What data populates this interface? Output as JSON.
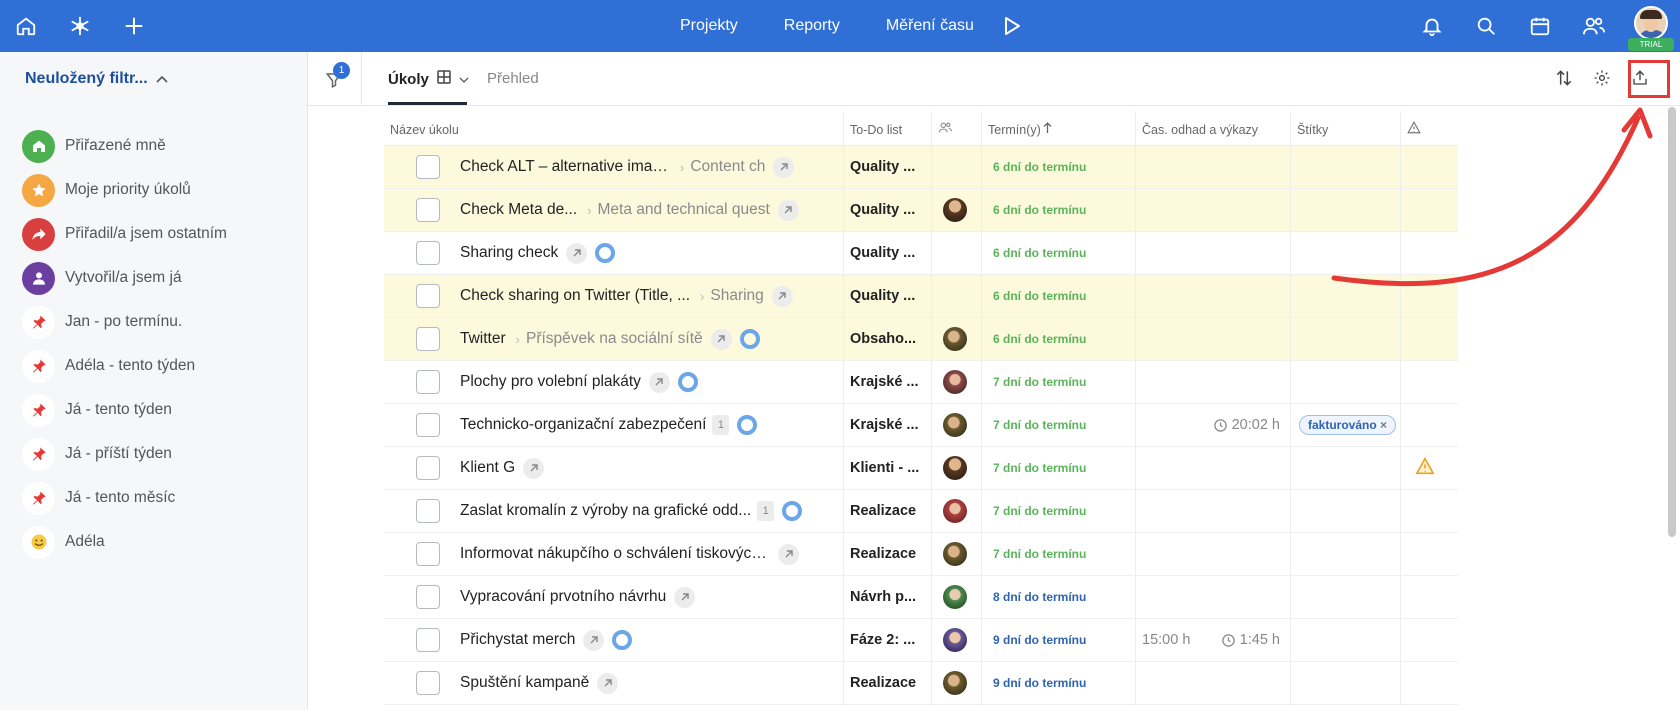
{
  "nav": {
    "links": [
      "Projekty",
      "Reporty",
      "Měření času"
    ],
    "trial_badge": "TRIAL",
    "brand_color": "#2f6fd6"
  },
  "sidebar": {
    "filter_title": "Neuložený filtr...",
    "items": [
      {
        "label": "Přiřazené mně",
        "icon": "home-icon",
        "color": "#4caf50"
      },
      {
        "label": "Moje priority úkolů",
        "icon": "star-icon",
        "color": "#f4a742"
      },
      {
        "label": "Přiřadil/a jsem ostatním",
        "icon": "share-arrow-icon",
        "color": "#d84040"
      },
      {
        "label": "Vytvořil/a jsem já",
        "icon": "person-icon",
        "color": "#6b3fa0"
      },
      {
        "label": "Jan - po termínu.",
        "icon": "pin-icon",
        "color": "#ffffff"
      },
      {
        "label": "Adéla - tento týden",
        "icon": "pin-icon",
        "color": "#ffffff"
      },
      {
        "label": "Já - tento týden",
        "icon": "pin-icon",
        "color": "#ffffff"
      },
      {
        "label": "Já - příští týden",
        "icon": "pin-icon",
        "color": "#ffffff"
      },
      {
        "label": "Já - tento měsíc",
        "icon": "pin-icon",
        "color": "#ffffff"
      },
      {
        "label": "Adéla",
        "icon": "smiley-icon",
        "color": "#ffffff"
      }
    ]
  },
  "filter_badge": "1",
  "tabs": {
    "active": "Úkoly",
    "inactive": "Přehled"
  },
  "table": {
    "headers": {
      "name": "Název úkolu",
      "todo": "To-Do list",
      "due": "Termín(y)",
      "time": "Čas. odhad a výkazy",
      "tags": "Štítky"
    },
    "rows": [
      {
        "name": "Check ALT – alternative imag...",
        "crumb": "Content ch",
        "todo": "Quality ...",
        "due": "6 dní do termínu",
        "highlight": true
      },
      {
        "name": "Check Meta de...",
        "crumb": "Meta and technical quest",
        "todo": "Quality ...",
        "due": "6 dní do termínu",
        "highlight": true
      },
      {
        "name": "Sharing check",
        "crumb": "",
        "todo": "Quality ...",
        "due": "6 dní do termínu",
        "highlight": false
      },
      {
        "name": "Check sharing on Twitter (Title, ...",
        "crumb": "Sharing",
        "todo": "Quality ...",
        "due": "6 dní do termínu",
        "highlight": true
      },
      {
        "name": "Twitter",
        "crumb": "Příspěvek na sociální sítě",
        "todo": "Obsaho...",
        "due": "6 dní do termínu",
        "highlight": true
      },
      {
        "name": "Plochy pro volební plakáty",
        "crumb": "",
        "todo": "Krajské ...",
        "due": "7 dní do termínu",
        "highlight": false
      },
      {
        "name": "Technicko-organizační zabezpečení",
        "crumb": "",
        "subcount": "1",
        "todo": "Krajské ...",
        "due": "7 dní do termínu",
        "time_spent": "20:02 h",
        "tag": "fakturováno",
        "highlight": false
      },
      {
        "name": "Klient G",
        "crumb": "",
        "todo": "Klienti - ...",
        "due": "7 dní do termínu",
        "warning": true,
        "highlight": false
      },
      {
        "name": "Zaslat kromalín z výroby na grafické odd...",
        "crumb": "",
        "subcount": "1",
        "todo": "Realizace",
        "due": "7 dní do termínu",
        "highlight": false
      },
      {
        "name": "Informovat nákupčího o schválení tiskových ...",
        "crumb": "",
        "todo": "Realizace",
        "due": "7 dní do termínu",
        "highlight": false
      },
      {
        "name": "Vypracování prvotního návrhu",
        "crumb": "",
        "todo": "Návrh p...",
        "due": "8 dní do termínu",
        "highlight": false
      },
      {
        "name": "Přichystat merch",
        "crumb": "",
        "todo": "Fáze 2: ...",
        "due": "9 dní do termínu",
        "time_est": "15:00 h",
        "time_spent": "1:45 h",
        "highlight": false
      },
      {
        "name": "Spuštění kampaně",
        "crumb": "",
        "todo": "Realizace",
        "due": "9 dní do termínu",
        "highlight": false
      }
    ]
  }
}
